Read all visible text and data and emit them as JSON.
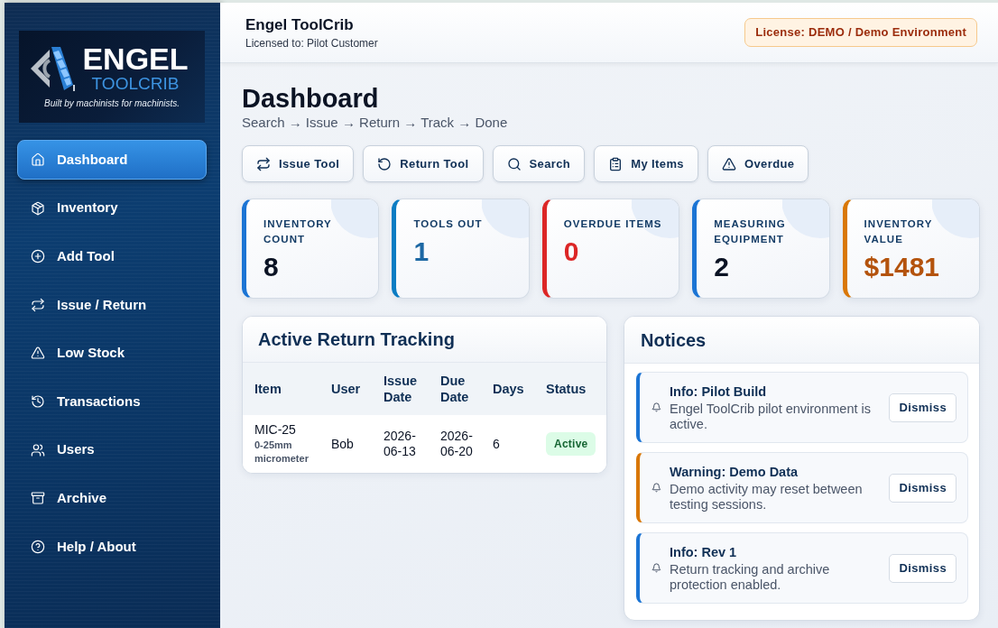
{
  "sidebar": {
    "logo": {
      "name": "ENGEL",
      "product": "TOOLCRIB",
      "tagline": "Built by machinists for machinists."
    },
    "items": [
      {
        "label": "Dashboard",
        "selected": true
      },
      {
        "label": "Inventory",
        "selected": false
      },
      {
        "label": "Add Tool",
        "selected": false
      },
      {
        "label": "Issue / Return",
        "selected": false
      },
      {
        "label": "Low Stock",
        "selected": false
      },
      {
        "label": "Transactions",
        "selected": false
      },
      {
        "label": "Users",
        "selected": false
      },
      {
        "label": "Archive",
        "selected": false
      },
      {
        "label": "Help / About",
        "selected": false
      }
    ]
  },
  "header": {
    "app_name": "Engel ToolCrib",
    "licensee": "Licensed to: Pilot Customer",
    "license_badge": "License: DEMO / Demo Environment"
  },
  "page": {
    "title": "Dashboard",
    "workflow": "Search → Issue → Return → Track → Done"
  },
  "actions": [
    "Issue Tool",
    "Return Tool",
    "Search",
    "My Items",
    "Overdue"
  ],
  "stats": [
    {
      "label": "INVENTORY COUNT",
      "value": "8",
      "kind": "plain"
    },
    {
      "label": "TOOLS OUT",
      "value": "1",
      "kind": "info"
    },
    {
      "label": "OVERDUE ITEMS",
      "value": "0",
      "kind": "danger"
    },
    {
      "label": "MEASURING EQUIPMENT",
      "value": "2",
      "kind": "plain"
    },
    {
      "label": "INVENTORY VALUE",
      "value": "$1481",
      "kind": "warning"
    }
  ],
  "return_tracking": {
    "title": "Active Return Tracking",
    "columns": [
      "Item",
      "User",
      "Issue Date",
      "Due Date",
      "Days",
      "Status"
    ],
    "rows": [
      {
        "item": "MIC-25",
        "item_detail": "0-25mm micrometer",
        "user": "Bob",
        "issue_date": "2026-06-13",
        "due_date": "2026-06-20",
        "days": "6",
        "status": "Active"
      }
    ]
  },
  "notices": {
    "title": "Notices",
    "items": [
      {
        "kind": "info",
        "title": "Info: Pilot Build",
        "message": "Engel ToolCrib pilot environment is active.",
        "action": "Dismiss"
      },
      {
        "kind": "warning",
        "title": "Warning: Demo Data",
        "message": "Demo activity may reset between testing sessions.",
        "action": "Dismiss"
      },
      {
        "kind": "info",
        "title": "Info: Rev 1",
        "message": "Return tracking and archive protection enabled.",
        "action": "Dismiss"
      }
    ]
  }
}
